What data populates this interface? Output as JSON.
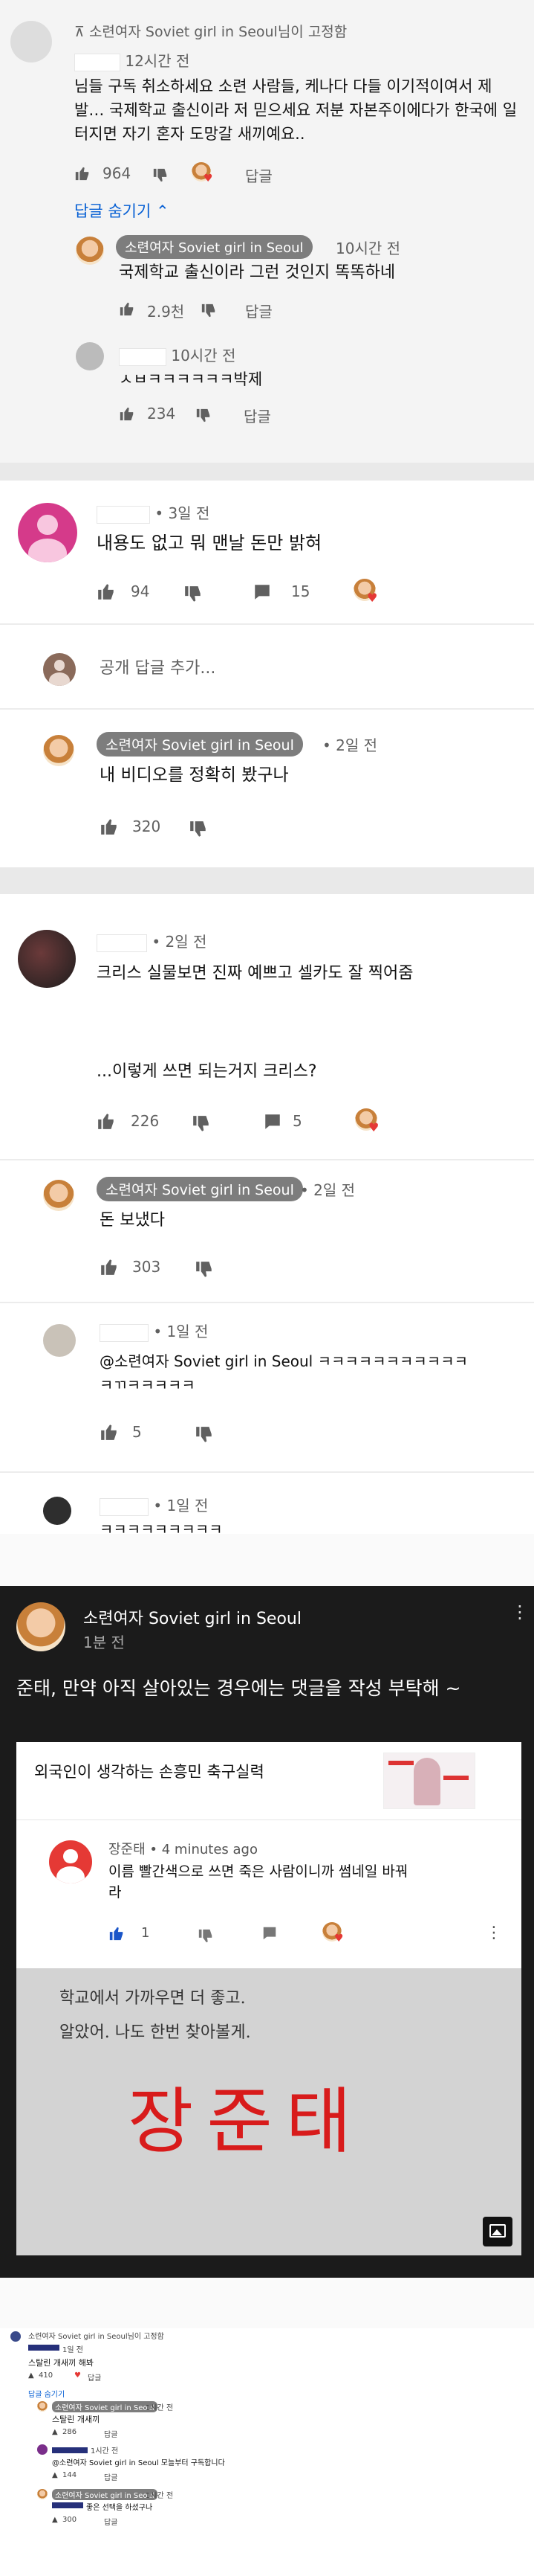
{
  "c1": {
    "pin": "소련여자 Soviet girl in Seoul님이 고정함",
    "time": "12시간 전",
    "text": "님들 구독 취소하세요 소련 사람들, 케나다 다들 이기적이여서 제발… 국제학교 출신이라 저 믿으세요 저분 자본주이에다가 한국에 일 터지면 자기 혼자 도망갈 새끼예요..",
    "likes": "964",
    "reply_label": "답글",
    "hide_replies": "답글 숨기기"
  },
  "c1r1": {
    "author": "소련여자 Soviet girl in Seoul",
    "time": "10시간 전",
    "text": "국제학교 출신이라 그런 것인지 똑똑하네",
    "likes": "2.9천",
    "reply_label": "답글"
  },
  "c1r2": {
    "time": "10시간 전",
    "text": "ㅅㅂㅋㅋㅋㅋㅋㅋ박제",
    "likes": "234",
    "reply_label": "답글"
  },
  "c2": {
    "time": "3일 전",
    "text": "내용도 없고 뭐 맨날 돈만 밝혀",
    "likes": "94",
    "replies": "15"
  },
  "c2add": {
    "label": "공개 답글 추가..."
  },
  "c2r1": {
    "author": "소련여자 Soviet girl in Seoul",
    "time": "2일 전",
    "text": "내 비디오를 정확히 봤구나",
    "likes": "320"
  },
  "c3": {
    "time": "2일 전",
    "text1": "크리스 실물보면 진짜 예쁘고 셀카도 잘 찍어줌",
    "text2": "...이렇게 쓰면 되는거지 크리스?",
    "likes": "226",
    "replies": "5"
  },
  "c3r1": {
    "author": "소련여자 Soviet girl in Seoul",
    "time": "2일 전",
    "text": "돈 보냈다",
    "likes": "303"
  },
  "c3r2": {
    "time": "1일 전",
    "text": "@소련여자 Soviet girl in Seoul ㅋㅋㅋㅋㅋㅋㅋㅋㅋㅋㅋㅋㄲㅋㅋㅋㅋㅋ",
    "likes": "5"
  },
  "c3r3": {
    "time": "1일 전",
    "text": "ㅋㅋㅋㅋㅋㅋㅋㅋㅋ"
  },
  "dark": {
    "author": "소련여자 Soviet girl in Seoul",
    "time": "1분 전",
    "text": "준태, 만약 아직 살아있는 경우에는 댓글을 작성 부탁해 ~",
    "card_title": "외국인이 생각하는 손흥민 축구실력",
    "card_author": "장준태",
    "card_time": "• 4 minutes ago",
    "card_text": "이름 빨간색으로 쓰면 죽은 사람이니까 썸네일 바꿔라",
    "card_likes": "1",
    "paper_line1": "학교에서 가까우면 더 좋고.",
    "paper_line2": "알았어. 나도 한번 찾아볼게.",
    "red_name": "장준태"
  },
  "mini": {
    "pin": "소련여자 Soviet girl in Seoul님이 고정함",
    "t1": "1일 전",
    "c1": "스탈린 개새끼 해봐",
    "l1": "410",
    "hide": "답글 숨기기",
    "r1name": "소련여자 Soviet girl in Seoul",
    "r1time": "1시간 전",
    "r1text": "스탈린 개새끼",
    "r1likes": "286",
    "r2time": "1시간 전",
    "r2text": "@소련여자 Soviet girl in Seoul 모늘부터 구독합니다",
    "r2likes": "144",
    "r3name": "소련여자 Soviet girl in Seoul",
    "r3time": "1시간 전",
    "r3text": "좋은 선택을 하셨구나",
    "r3likes": "300",
    "reply": "답글"
  }
}
